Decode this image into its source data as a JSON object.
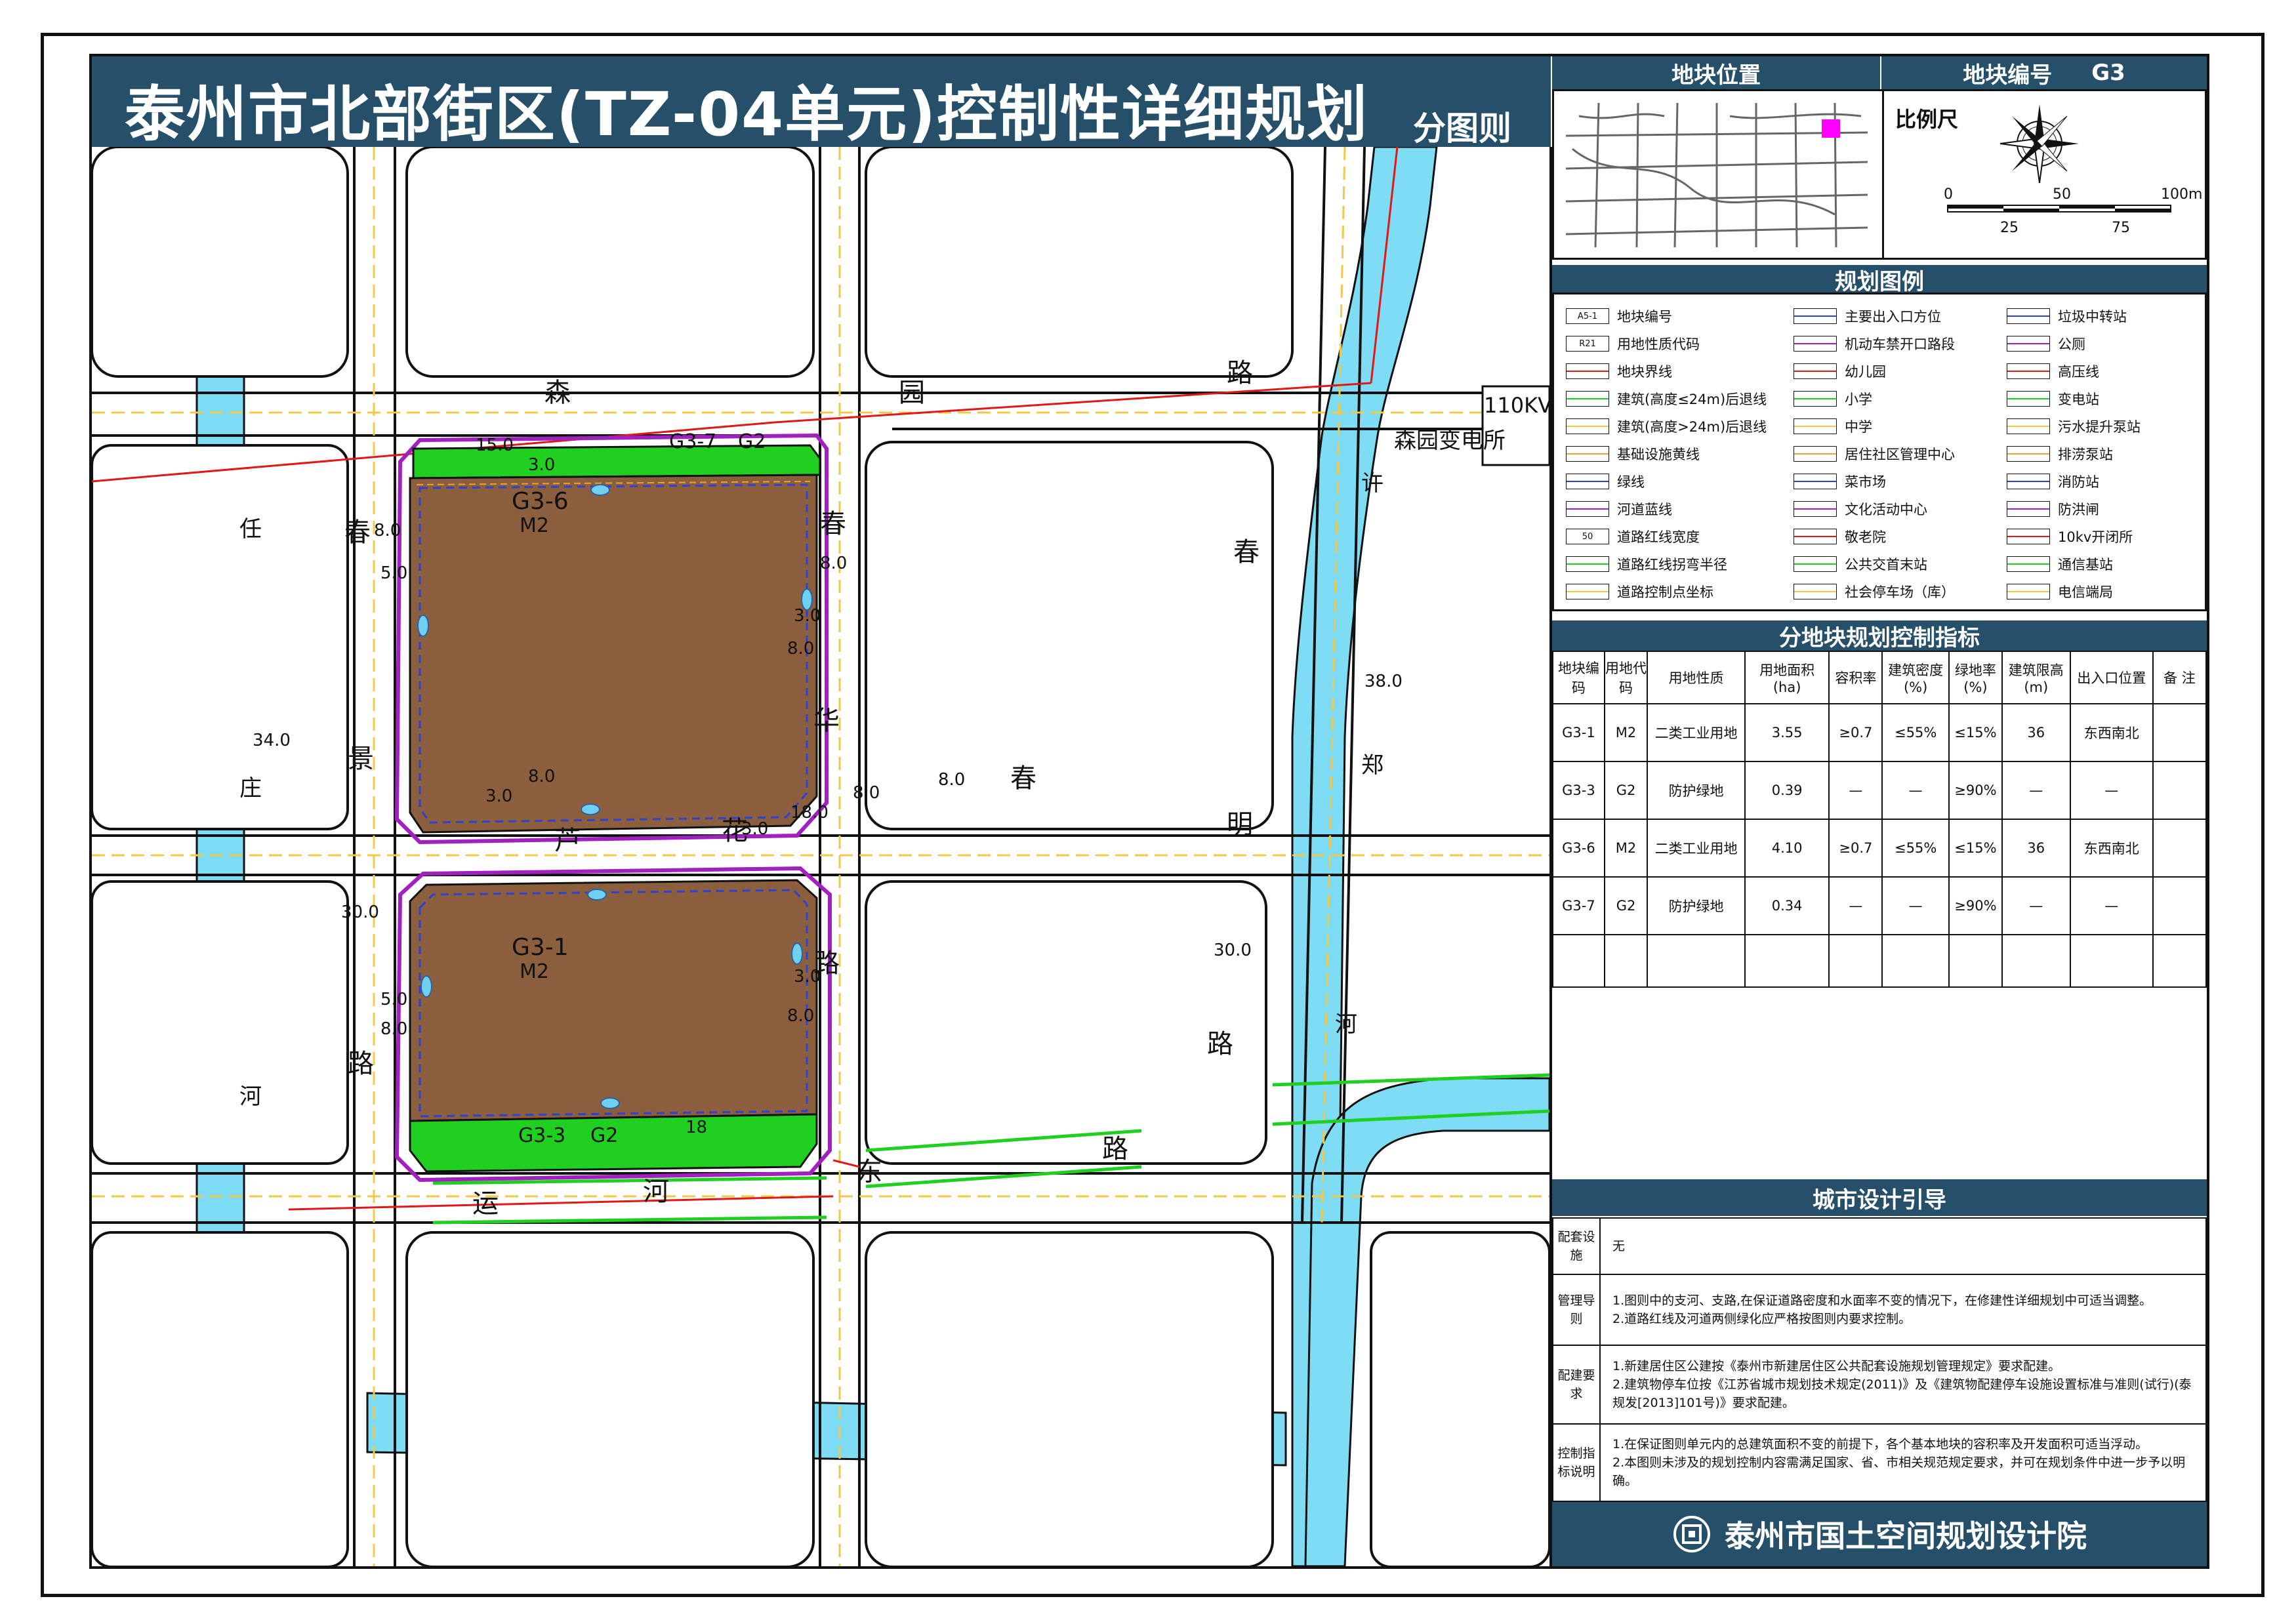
{
  "title": "泰州市北部街区(TZ-04单元)控制性详细规划",
  "subtitle": "分图则",
  "panel": {
    "location_label": "地块位置",
    "code_label": "地块编号",
    "code_value": "G3",
    "scale_label": "比例尺",
    "scale_ticks_top": [
      "0",
      "50",
      "100m"
    ],
    "scale_ticks_bottom": [
      "25",
      "75"
    ],
    "legend_title": "规划图例",
    "control_title": "分地块规划控制指标",
    "guide_title": "城市设计引导",
    "footer": "泰州市国土空间规划设计院"
  },
  "legend": {
    "col1": [
      {
        "sym": "A5-1",
        "label": "地块编号"
      },
      {
        "sym": "R21",
        "label": "用地性质代码"
      },
      {
        "sym": "",
        "label": "地块界线"
      },
      {
        "sym": "",
        "label": "建筑(高度≤24m)后退线"
      },
      {
        "sym": "",
        "label": "建筑(高度>24m)后退线"
      },
      {
        "sym": "",
        "label": "基础设施黄线"
      },
      {
        "sym": "",
        "label": "绿线"
      },
      {
        "sym": "",
        "label": "河道蓝线"
      },
      {
        "sym": "50",
        "label": "道路红线宽度"
      },
      {
        "sym": "",
        "label": "道路红线拐弯半径"
      },
      {
        "sym": "",
        "label": "道路控制点坐标"
      }
    ],
    "col2": [
      {
        "label": "主要出入口方位"
      },
      {
        "label": "机动车禁开口路段"
      },
      {
        "label": "幼儿园"
      },
      {
        "label": "小学"
      },
      {
        "label": "中学"
      },
      {
        "label": "居住社区管理中心"
      },
      {
        "label": "菜市场"
      },
      {
        "label": "文化活动中心"
      },
      {
        "label": "敬老院"
      },
      {
        "label": "公共交首末站"
      },
      {
        "label": "社会停车场（库）"
      }
    ],
    "col3": [
      {
        "label": "垃圾中转站"
      },
      {
        "label": "公厕"
      },
      {
        "label": "高压线"
      },
      {
        "label": "变电站"
      },
      {
        "label": "污水提升泵站"
      },
      {
        "label": "排涝泵站"
      },
      {
        "label": "消防站"
      },
      {
        "label": "防洪闸"
      },
      {
        "label": "10kv开闭所"
      },
      {
        "label": "通信基站"
      },
      {
        "label": "电信端局"
      }
    ]
  },
  "control_table": {
    "headers": [
      "地块编码",
      "用地代码",
      "用地性质",
      "用地面积(ha)",
      "容积率",
      "建筑密度(%)",
      "绿地率(%)",
      "建筑限高(m)",
      "出入口位置",
      "备 注"
    ],
    "rows": [
      [
        "G3-1",
        "M2",
        "二类工业用地",
        "3.55",
        "≥0.7",
        "≤55%",
        "≤15%",
        "36",
        "东西南北",
        ""
      ],
      [
        "G3-3",
        "G2",
        "防护绿地",
        "0.39",
        "—",
        "—",
        "≥90%",
        "—",
        "—",
        ""
      ],
      [
        "G3-6",
        "M2",
        "二类工业用地",
        "4.10",
        "≥0.7",
        "≤55%",
        "≤15%",
        "36",
        "东西南北",
        ""
      ],
      [
        "G3-7",
        "G2",
        "防护绿地",
        "0.34",
        "—",
        "—",
        "≥90%",
        "—",
        "—",
        ""
      ]
    ]
  },
  "guide": {
    "facilities_label": "配套设施",
    "facilities_text": "无",
    "management_label": "管理导则",
    "management_lines": [
      "1.图则中的支河、支路,在保证道路密度和水面率不变的情况下，在修建性详细规划中可适当调整。",
      "2.道路红线及河道两侧绿化应严格按图则内要求控制。"
    ],
    "provision_label": "配建要求",
    "provision_lines": [
      "1.新建居住区公建按《泰州市新建居住区公共配套设施规划管理规定》要求配建。",
      "2.建筑物停车位按《江苏省城市规划技术规定(2011)》及《建筑物配建停车设施设置标准与准则(试行)(泰规发[2013]101号)》要求配建。"
    ],
    "control_label": "控制指标说明",
    "control_lines": [
      "1.在保证图则单元内的总建筑面积不变的前提下，各个基本地块的容积率及开发面积可适当浮动。",
      "2.本图则未涉及的规划控制内容需满足国家、省、市相关规范规定要求，并可在规划条件中进一步予以明确。"
    ]
  },
  "map": {
    "parcels": [
      {
        "code": "G3-6",
        "use": "M2"
      },
      {
        "code": "G3-1",
        "use": "M2"
      },
      {
        "code": "G3-7",
        "use": "G2"
      },
      {
        "code": "G3-3",
        "use": "G2"
      }
    ],
    "road_chars": {
      "sy": [
        "森",
        "园",
        "路"
      ],
      "ch": [
        "春",
        "华",
        "路"
      ],
      "jl": [
        "景",
        "路"
      ],
      "luhua": [
        "芦",
        "花"
      ],
      "cm": [
        "春",
        "明",
        "路"
      ],
      "yh": [
        "运",
        "河",
        "东",
        "路"
      ],
      "rz": [
        "任",
        "庄",
        "河"
      ],
      "xz": [
        "许",
        "郑",
        "河"
      ],
      "chun": [
        "春"
      ]
    },
    "substation": "110KV",
    "substation_name": "森园变电所",
    "dims": [
      "15.0",
      "3.0",
      "8.0",
      "5.0",
      "8.0",
      "3.0",
      "8.0",
      "8.0",
      "3.0",
      "3.0",
      "8.0",
      "18.0",
      "3.0",
      "8.0",
      "3.0",
      "3.0",
      "8.0",
      "8.0",
      "5.0",
      "3.0",
      "8.0",
      "18",
      "34.0",
      "30.0",
      "38.0",
      "30.0",
      "8.0"
    ]
  },
  "colors": {
    "header_bg": "#26506a",
    "parcel_fill": "#8b5f3e",
    "green": "#20d020",
    "river": "#7fdcf5",
    "boundary": "#a020c0",
    "red_line": "#e01818",
    "yellow_line": "#f0c84a"
  }
}
